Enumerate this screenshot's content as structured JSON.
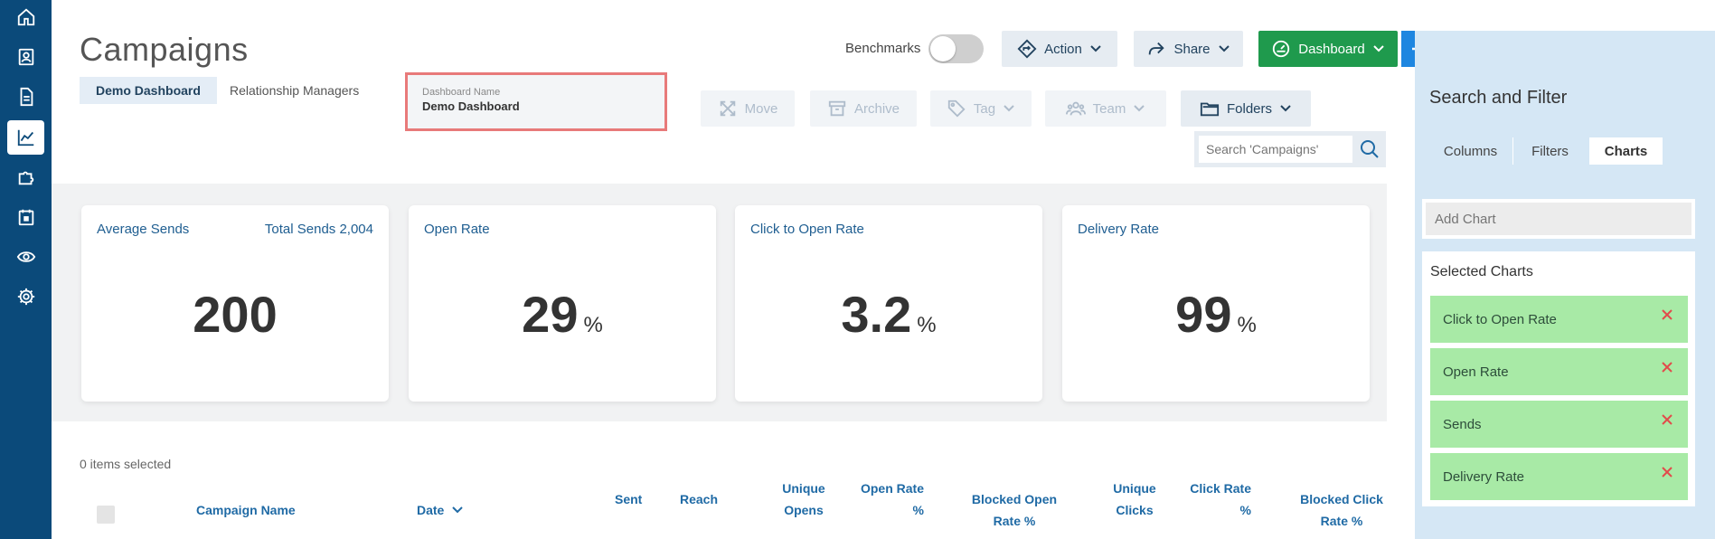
{
  "nav": {
    "items": [
      {
        "icon": "home-icon",
        "active": false
      },
      {
        "icon": "contacts-icon",
        "active": false
      },
      {
        "icon": "document-icon",
        "active": false
      },
      {
        "icon": "chart-line-icon",
        "active": true
      },
      {
        "icon": "puzzle-icon",
        "active": false
      },
      {
        "icon": "calendar-icon",
        "active": false
      },
      {
        "icon": "eye-icon",
        "active": false
      },
      {
        "icon": "gear-icon",
        "active": false
      }
    ]
  },
  "header": {
    "title": "Campaigns",
    "tabs": [
      {
        "label": "Demo Dashboard",
        "active": true
      },
      {
        "label": "Relationship Managers",
        "active": false
      }
    ],
    "dashboard_name": {
      "label": "Dashboard Name",
      "value": "Demo Dashboard"
    },
    "benchmarks_label": "Benchmarks",
    "benchmarks_on": false
  },
  "toolbar": {
    "action_label": "Action",
    "share_label": "Share",
    "dashboard_label": "Dashboard",
    "move_label": "Move",
    "archive_label": "Archive",
    "tag_label": "Tag",
    "team_label": "Team",
    "folders_label": "Folders"
  },
  "search": {
    "placeholder": "Search 'Campaigns'"
  },
  "cards": [
    {
      "title": "Average Sends",
      "right": "Total Sends 2,004",
      "value": "200",
      "unit": ""
    },
    {
      "title": "Open Rate",
      "right": "",
      "value": "29",
      "unit": "%"
    },
    {
      "title": "Click to Open Rate",
      "right": "",
      "value": "3.2",
      "unit": "%"
    },
    {
      "title": "Delivery Rate",
      "right": "",
      "value": "99",
      "unit": "%"
    }
  ],
  "table": {
    "selected_count": "0 items selected",
    "columns": {
      "campaign_name": "Campaign Name",
      "date": "Date",
      "sent": "Sent",
      "reach": "Reach",
      "unique_opens_1": "Unique",
      "unique_opens_2": "Opens",
      "open_rate_1": "Open Rate",
      "open_rate_2": "%",
      "blocked_open_1": "Blocked Open",
      "blocked_open_2": "Rate %",
      "unique_clicks_1": "Unique",
      "unique_clicks_2": "Clicks",
      "click_rate_1": "Click Rate",
      "click_rate_2": "%",
      "blocked_click_1": "Blocked Click",
      "blocked_click_2": "Rate %"
    }
  },
  "panel": {
    "title": "Search and Filter",
    "tabs": [
      {
        "label": "Columns",
        "active": false
      },
      {
        "label": "Filters",
        "active": false
      },
      {
        "label": "Charts",
        "active": true
      }
    ],
    "add_chart_placeholder": "Add Chart",
    "selected_title": "Selected Charts",
    "selected_charts": [
      "Click to Open Rate",
      "Open Rate",
      "Sends",
      "Delivery Rate"
    ]
  },
  "colors": {
    "nav_bg": "#0b4a7a",
    "accent_blue": "#1e86e0",
    "green": "#1f9a4d",
    "chip_green": "#a8eaa6",
    "highlight_red": "#e87a7a"
  }
}
